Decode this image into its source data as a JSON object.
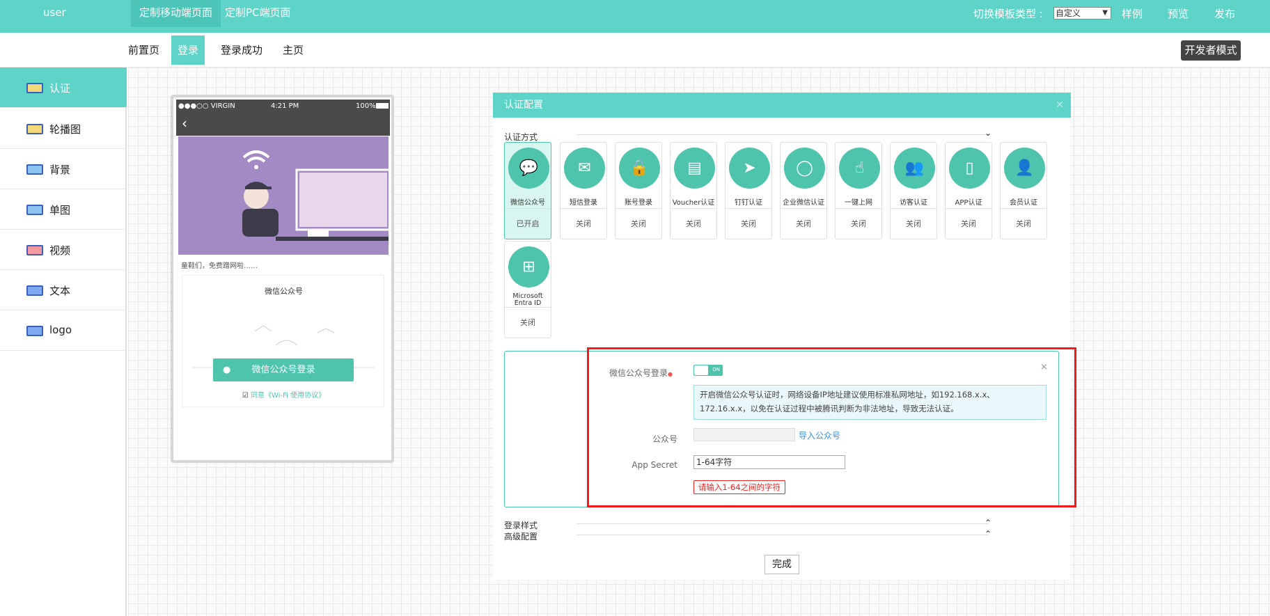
{
  "header": {
    "user": "user",
    "tabs": [
      "定制移动端页面",
      "定制PC端页面"
    ],
    "switch_label": "切换模板类型 :",
    "template_select": "自定义",
    "example": "样例",
    "preview": "预览",
    "publish": "发布"
  },
  "subnav": {
    "tabs": [
      "前置页",
      "登录",
      "登录成功",
      "主页"
    ],
    "dev_mode": "开发者模式"
  },
  "sidebar": {
    "items": [
      {
        "label": "认证",
        "icon": "display-icon"
      },
      {
        "label": "轮播图",
        "icon": "display-icon"
      },
      {
        "label": "背景",
        "icon": "image-icon"
      },
      {
        "label": "单图",
        "icon": "image-icon"
      },
      {
        "label": "视频",
        "icon": "video-icon"
      },
      {
        "label": "文本",
        "icon": "text-icon"
      },
      {
        "label": "logo",
        "icon": "logo-icon"
      }
    ]
  },
  "phone": {
    "carrier": "●●●○○ VIRGIN",
    "time": "4:21 PM",
    "battery": "100%",
    "caption": "童鞋们，免费蹭网啦……",
    "card_title": "微信公众号",
    "login_button": "微信公众号登录",
    "agreement": "同意《Wi-Fi 使用协议》"
  },
  "panel": {
    "title": "认证配置",
    "auth_method_label": "认证方式",
    "methods": [
      {
        "name": "微信公众号",
        "status": "已开启",
        "icon": "wechat-icon"
      },
      {
        "name": "短信登录",
        "status": "关闭",
        "icon": "mail-icon"
      },
      {
        "name": "账号登录",
        "status": "关闭",
        "icon": "lock-icon"
      },
      {
        "name": "Voucher认证",
        "status": "关闭",
        "icon": "voucher-icon"
      },
      {
        "name": "钉钉认证",
        "status": "关闭",
        "icon": "dingtalk-icon"
      },
      {
        "name": "企业微信认证",
        "status": "关闭",
        "icon": "wecom-icon"
      },
      {
        "name": "一键上网",
        "status": "关闭",
        "icon": "touch-icon"
      },
      {
        "name": "访客认证",
        "status": "关闭",
        "icon": "guest-icon"
      },
      {
        "name": "APP认证",
        "status": "关闭",
        "icon": "phone-icon"
      },
      {
        "name": "会员认证",
        "status": "关闭",
        "icon": "member-icon"
      },
      {
        "name": "Microsoft Entra ID",
        "status": "关闭",
        "icon": "windows-icon"
      }
    ],
    "wechat_login_label": "微信公众号登录",
    "toggle": "ON",
    "note": "开启微信公众号认证时，网络设备IP地址建议使用标准私网地址，如192.168.x.x、172.16.x.x，以免在认证过程中被腾讯判断为非法地址，导致无法认证。",
    "official_account_label": "公众号",
    "import_link": "导入公众号",
    "secret_label": "App Secret",
    "secret_placeholder": "1-64字符",
    "error": "请输入1-64之间的字符",
    "login_style": "登录样式",
    "advanced": "高级配置",
    "done": "完成"
  }
}
